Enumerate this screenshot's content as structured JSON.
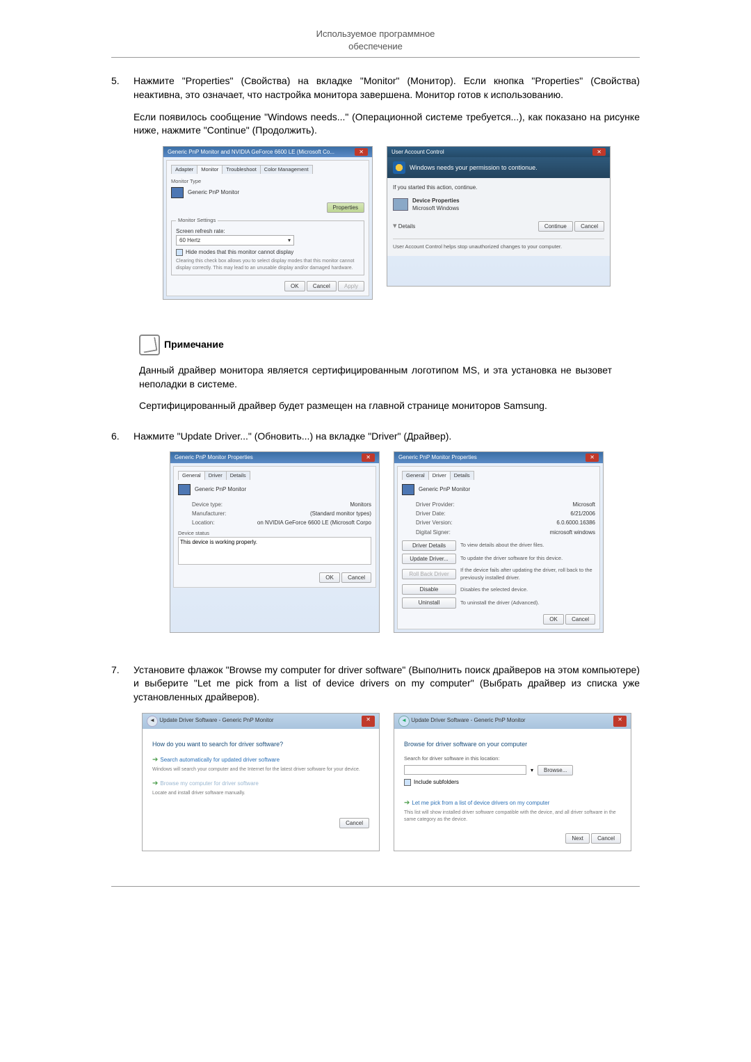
{
  "header": {
    "line1": "Используемое программное",
    "line2": "обеспечение"
  },
  "steps": {
    "s5": {
      "num": "5.",
      "p1": "Нажмите \"Properties\" (Свойства) на вкладке \"Monitor\" (Монитор). Если кнопка \"Properties\" (Свойства) неактивна, это означает, что настройка монитора завершена. Монитор готов к использованию.",
      "p2": "Если появилось сообщение \"Windows needs...\" (Операционной системе требуется...), как показано на рисунке ниже, нажмите \"Continue\" (Продолжить)."
    },
    "s6": {
      "num": "6.",
      "p1": "Нажмите \"Update Driver...\" (Обновить...) на вкладке \"Driver\" (Драйвер)."
    },
    "s7": {
      "num": "7.",
      "p1": "Установите флажок \"Browse my computer for driver software\" (Выполнить поиск драйверов на этом компьютере) и выберите \"Let me pick from a list of device drivers on my computer\" (Выбрать драйвер из списка уже установленных драйверов)."
    }
  },
  "note": {
    "title": "Примечание",
    "p1": "Данный драйвер монитора является сертифицированным логотипом MS, и эта установка не вызовет неполадки в системе.",
    "p2": "Сертифицированный драйвер будет размещен на главной странице мониторов Samsung."
  },
  "monitorDlg": {
    "title": "Generic PnP Monitor and NVIDIA GeForce 6600 LE (Microsoft Co...",
    "tabs": [
      "Adapter",
      "Monitor",
      "Troubleshoot",
      "Color Management"
    ],
    "monType": "Monitor Type",
    "monName": "Generic PnP Monitor",
    "props": "Properties",
    "settings": "Monitor Settings",
    "refreshLbl": "Screen refresh rate:",
    "refreshVal": "60 Hertz",
    "hide": "Hide modes that this monitor cannot display",
    "hideDesc": "Clearing this check box allows you to select display modes that this monitor cannot display correctly. This may lead to an unusable display and/or damaged hardware.",
    "ok": "OK",
    "cancel": "Cancel",
    "apply": "Apply"
  },
  "uac": {
    "title": "User Account Control",
    "band": "Windows needs your permission to contionue.",
    "started": "If you started this action, continue.",
    "dev1": "Device Properties",
    "dev2": "Microsoft Windows",
    "details": "Details",
    "cont": "Continue",
    "cancel": "Cancel",
    "footer": "User Account Control helps stop unauthorized changes to your computer."
  },
  "propsGeneral": {
    "title": "Generic PnP Monitor Properties",
    "tabs": [
      "General",
      "Driver",
      "Details"
    ],
    "name": "Generic PnP Monitor",
    "rows": {
      "type": {
        "l": "Device type:",
        "v": "Monitors"
      },
      "mfr": {
        "l": "Manufacturer:",
        "v": "(Standard monitor types)"
      },
      "loc": {
        "l": "Location:",
        "v": "on NVIDIA GeForce 6600 LE (Microsoft Corpo"
      }
    },
    "statusLbl": "Device status",
    "statusTxt": "This device is working properly.",
    "ok": "OK",
    "cancel": "Cancel"
  },
  "propsDriver": {
    "title": "Generic PnP Monitor Properties",
    "tabs": [
      "General",
      "Driver",
      "Details"
    ],
    "name": "Generic PnP Monitor",
    "rows": {
      "prov": {
        "l": "Driver Provider:",
        "v": "Microsoft"
      },
      "date": {
        "l": "Driver Date:",
        "v": "6/21/2006"
      },
      "ver": {
        "l": "Driver Version:",
        "v": "6.0.6000.16386"
      },
      "sig": {
        "l": "Digital Signer:",
        "v": "microsoft windows"
      }
    },
    "btns": {
      "details": {
        "l": "Driver Details",
        "d": "To view details about the driver files."
      },
      "update": {
        "l": "Update Driver...",
        "d": "To update the driver software for this device."
      },
      "rollback": {
        "l": "Roll Back Driver",
        "d": "If the device fails after updating the driver, roll back to the previously installed driver."
      },
      "disable": {
        "l": "Disable",
        "d": "Disables the selected device."
      },
      "uninst": {
        "l": "Uninstall",
        "d": "To uninstall the driver (Advanced)."
      }
    },
    "ok": "OK",
    "cancel": "Cancel"
  },
  "wiz1": {
    "title": "Update Driver Software - Generic PnP Monitor",
    "q": "How do you want to search for driver software?",
    "opt1": "Search automatically for updated driver software",
    "opt1d": "Windows will search your computer and the Internet for the latest driver software for your device.",
    "opt2": "Browse my computer for driver software",
    "opt2d": "Locate and install driver software manually.",
    "cancel": "Cancel"
  },
  "wiz2": {
    "title": "Update Driver Software - Generic PnP Monitor",
    "h": "Browse for driver software on your computer",
    "searchLbl": "Search for driver software in this location:",
    "browse": "Browse...",
    "include": "Include subfolders",
    "optPick": "Let me pick from a list of device drivers on my computer",
    "optPickD": "This list will show installed driver software compatible with the device, and all driver software in the same category as the device.",
    "next": "Next",
    "cancel": "Cancel"
  }
}
